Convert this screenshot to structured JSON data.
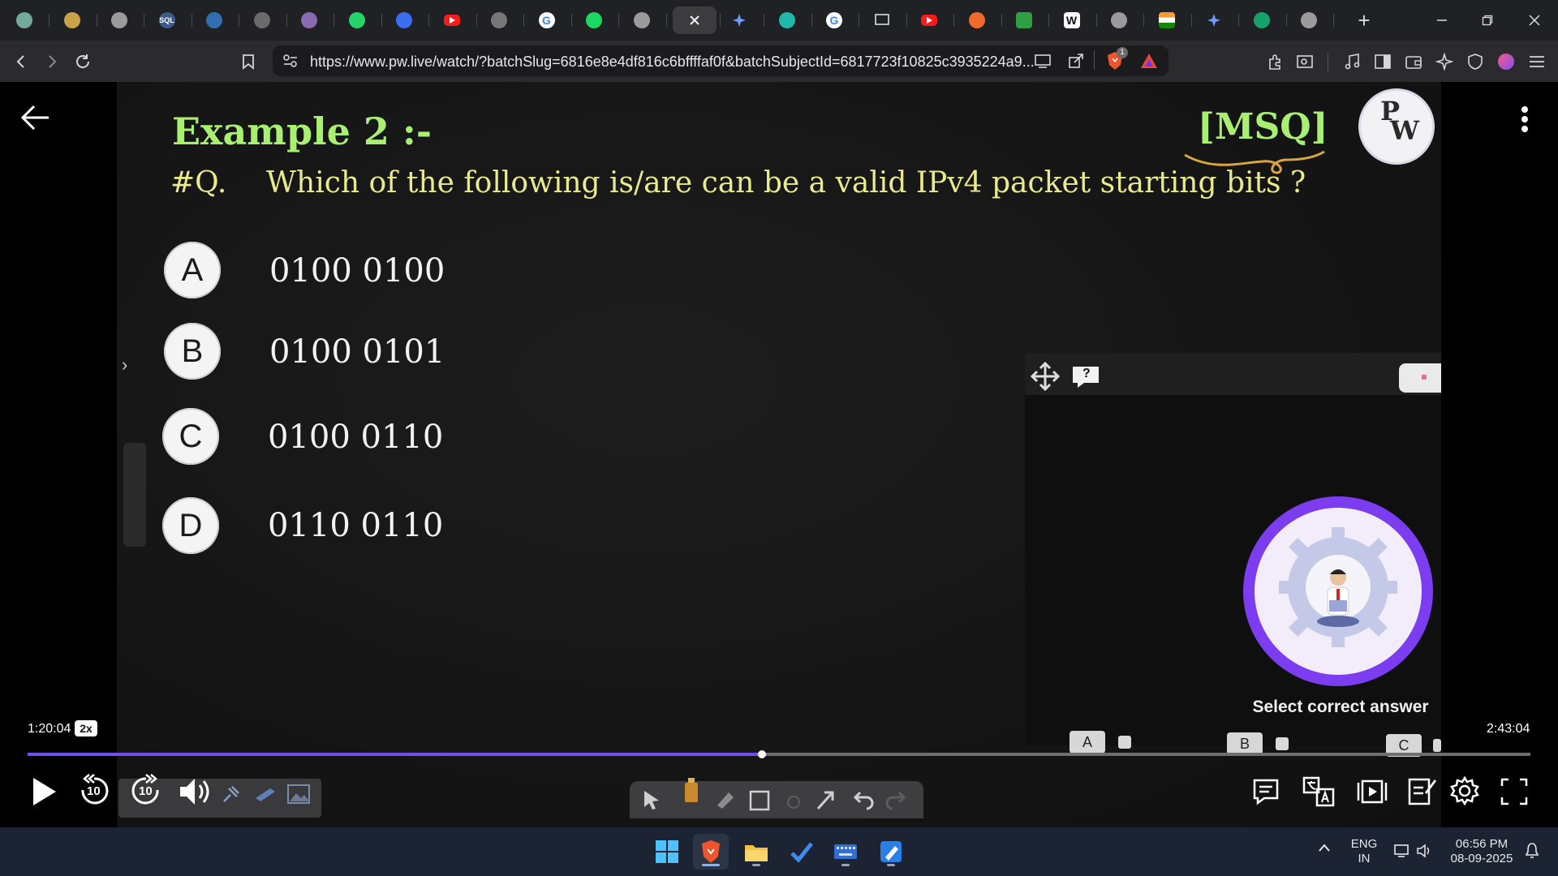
{
  "browser": {
    "url": "https://www.pw.live/watch/?batchSlug=6816e8e4df816c6bffffaf0f&batchSubjectId=6817723f10825c3935224a9...",
    "tabs": [
      {
        "icon": "chatgpt-icon"
      },
      {
        "icon": "coin-icon"
      },
      {
        "icon": "globe-icon"
      },
      {
        "icon": "sql-icon",
        "text": "SQL"
      },
      {
        "icon": "wordpress-icon"
      },
      {
        "icon": "site-icon"
      },
      {
        "icon": "avatar-icon"
      },
      {
        "icon": "whatsapp-icon"
      },
      {
        "icon": "bookmark-app-icon"
      },
      {
        "icon": "youtube-icon"
      },
      {
        "icon": "gate-icon"
      },
      {
        "icon": "google-icon",
        "text": "G"
      },
      {
        "icon": "spotify-icon"
      },
      {
        "icon": "globe-icon"
      },
      {
        "icon": "close-icon",
        "active": true
      },
      {
        "icon": "gemini-icon"
      },
      {
        "icon": "perplexity-icon"
      },
      {
        "icon": "google-icon",
        "text": "G"
      },
      {
        "icon": "monitor-icon"
      },
      {
        "icon": "youtube-icon"
      },
      {
        "icon": "brave-news-icon"
      },
      {
        "icon": "leetcode-icon"
      },
      {
        "icon": "wikipedia-icon",
        "text": "W"
      },
      {
        "icon": "globe-icon"
      },
      {
        "icon": "india-flag-icon"
      },
      {
        "icon": "gemini-icon"
      },
      {
        "icon": "grammar-icon"
      },
      {
        "icon": "globe-icon"
      }
    ],
    "brave_shield_badge": "1",
    "colors": {
      "tabstrip": "#202124",
      "toolbar": "#2b2b2e"
    }
  },
  "slide": {
    "title": "Example 2 :-",
    "tag": "[MSQ]",
    "logo_letters": [
      "P",
      "W"
    ],
    "question_label": "#Q.",
    "question": "Which of the following is/are can be a valid IPv4 packet starting bits ?",
    "options": [
      {
        "letter": "A",
        "text": "0100 0100"
      },
      {
        "letter": "B",
        "text": "0100 0101"
      },
      {
        "letter": "C",
        "text": "0100 0110"
      },
      {
        "letter": "D",
        "text": "0110 0110"
      }
    ],
    "colors": {
      "title": "#a8ef72",
      "question": "#eaea8a",
      "background": "#151515"
    }
  },
  "quiz": {
    "help": "?",
    "prompt": "Select correct answer",
    "answers": [
      "A",
      "B",
      "C"
    ],
    "accent": "#7c3cf0"
  },
  "player": {
    "current_time": "1:20:04",
    "speed": "2x",
    "total_time": "2:43:04",
    "progress": 0.4889,
    "rewind_seconds": "10",
    "forward_seconds": "10",
    "progress_color": "#6f4ef2"
  },
  "taskbar": {
    "language": "ENG",
    "region": "IN",
    "time": "06:56 PM",
    "date": "08-09-2025"
  }
}
